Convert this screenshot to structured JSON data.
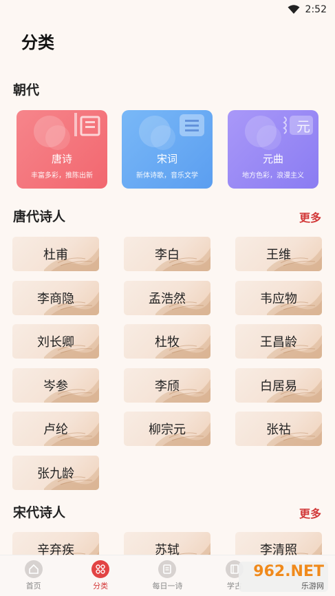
{
  "status": {
    "time": "2:52"
  },
  "page": {
    "title": "分类"
  },
  "dynasty": {
    "title": "朝代",
    "cards": [
      {
        "name": "唐诗",
        "desc": "丰富多彩，推陈出新",
        "color": "#f27f85",
        "icon": "book-icon"
      },
      {
        "name": "宋词",
        "desc": "新体诗歌，音乐文学",
        "color": "#6aacf4",
        "icon": "book-icon"
      },
      {
        "name": "元曲",
        "desc": "地方色彩，浪漫主义",
        "color": "#9a8cf6",
        "icon": "scroll-icon",
        "deco_text": "元"
      }
    ]
  },
  "tang": {
    "title": "唐代诗人",
    "more": "更多",
    "poets": [
      "杜甫",
      "李白",
      "王维",
      "李商隐",
      "孟浩然",
      "韦应物",
      "刘长卿",
      "杜牧",
      "王昌龄",
      "岑参",
      "李颀",
      "白居易",
      "卢纶",
      "柳宗元",
      "张祜",
      "张九龄"
    ]
  },
  "song": {
    "title": "宋代诗人",
    "more": "更多",
    "poets": [
      "辛弃疾",
      "苏轼",
      "李清照"
    ]
  },
  "nav": [
    {
      "label": "首页",
      "icon": "home-icon",
      "active": false
    },
    {
      "label": "分类",
      "icon": "grid-icon",
      "active": true
    },
    {
      "label": "每日一诗",
      "icon": "calendar-icon",
      "active": false
    },
    {
      "label": "学古",
      "icon": "book-icon",
      "active": false
    }
  ],
  "watermark": {
    "line1": "962.NET",
    "line2": "乐游网"
  }
}
